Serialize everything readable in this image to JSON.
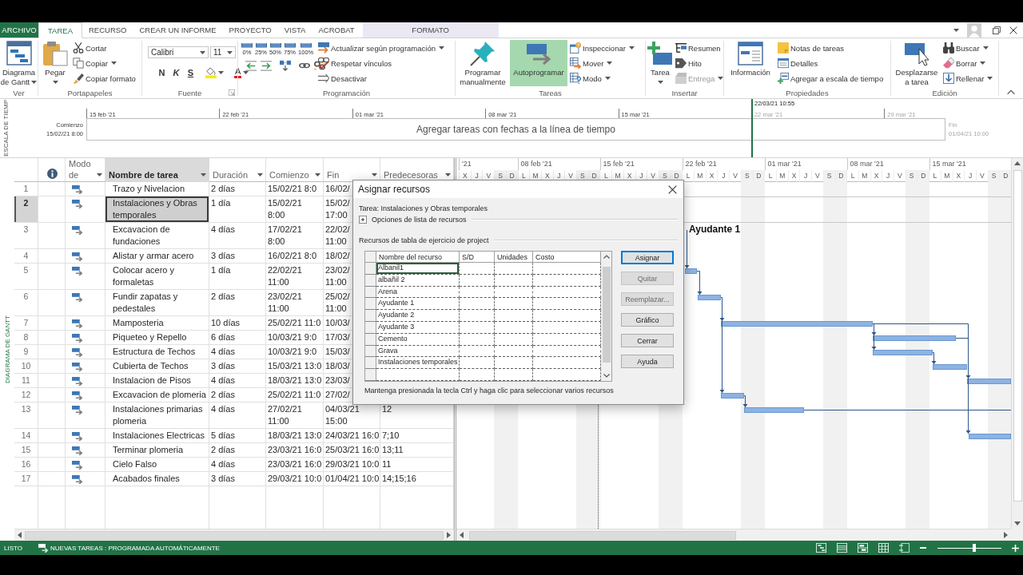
{
  "ribbon": {
    "tabs": [
      {
        "label": "ARCHIVO",
        "kind": "file",
        "selected": false
      },
      {
        "label": "TAREA",
        "kind": "tab",
        "selected": true
      },
      {
        "label": "RECURSO",
        "kind": "tab",
        "selected": false
      },
      {
        "label": "CREAR UN INFORME",
        "kind": "tab",
        "selected": false
      },
      {
        "label": "PROYECTO",
        "kind": "tab",
        "selected": false
      },
      {
        "label": "VISTA",
        "kind": "tab",
        "selected": false
      },
      {
        "label": "ACROBAT",
        "kind": "tab",
        "selected": false
      },
      {
        "label": "FORMATO",
        "kind": "contextual",
        "selected": false
      }
    ],
    "groups": [
      {
        "label": "Ver",
        "large": [
          {
            "label": "Diagrama de Gantt",
            "dropdown": true
          }
        ]
      },
      {
        "label": "Portapapeles",
        "large": [
          {
            "label": "Pegar",
            "dropdown": true
          }
        ],
        "small": [
          {
            "label": "Cortar",
            "dropdown": false
          },
          {
            "label": "Copiar",
            "dropdown": true
          },
          {
            "label": "Copiar formato",
            "dropdown": false
          }
        ]
      },
      {
        "label": "Fuente",
        "font": "Calibri",
        "size": "11",
        "format": [
          {
            "label": "N",
            "dropdown": false
          },
          {
            "label": "K",
            "dropdown": false
          },
          {
            "label": "S",
            "dropdown": false
          },
          {
            "dropdown": true
          },
          {
            "label": "A",
            "dropdown": true
          }
        ]
      },
      {
        "label": "Programación",
        "percent": [
          "0%",
          "25%",
          "50%",
          "75%",
          "100%"
        ],
        "small": [
          {
            "label": "Actualizar según programación",
            "dropdown": true
          },
          {
            "label": "Respetar vínculos",
            "dropdown": false
          },
          {
            "label": "Desactivar",
            "dropdown": false
          }
        ]
      },
      {
        "label": "Tareas",
        "large": [
          {
            "label": "Programar manualmente",
            "selected": false
          },
          {
            "label": "Autoprogramar",
            "selected": true
          }
        ],
        "small": [
          {
            "label": "Inspeccionar",
            "dropdown": true
          },
          {
            "label": "Mover",
            "dropdown": true
          },
          {
            "label": "Modo",
            "dropdown": true
          }
        ]
      },
      {
        "label": "Insertar",
        "large": [
          {
            "label": "Tarea",
            "dropdown": true
          }
        ],
        "small": [
          {
            "label": "Resumen",
            "dropdown": false,
            "disabled": false
          },
          {
            "label": "Hito",
            "dropdown": false,
            "disabled": false
          },
          {
            "label": "Entrega",
            "dropdown": true,
            "disabled": true
          }
        ]
      },
      {
        "label": "Propiedades",
        "large": [
          {
            "label": "Información"
          }
        ],
        "small": [
          {
            "label": "Notas de tareas"
          },
          {
            "label": "Detalles"
          },
          {
            "label": "Agregar a escala de tiempo"
          }
        ]
      },
      {
        "label": "Edición",
        "large": [
          {
            "label": "Desplazarse a tarea"
          }
        ],
        "small": [
          {
            "label": "Buscar",
            "dropdown": true
          },
          {
            "label": "Borrar",
            "dropdown": true
          },
          {
            "label": "Rellenar",
            "dropdown": true
          }
        ]
      }
    ]
  },
  "timeline": {
    "side_label": "ESCALA DE TIEMP",
    "current_date": "22/03/21 10:55",
    "ticks": [
      {
        "label": "15 feb '21",
        "dimmed": false
      },
      {
        "label": "22 feb '21",
        "dimmed": false
      },
      {
        "label": "01 mar '21",
        "dimmed": false
      },
      {
        "label": "08 mar '21",
        "dimmed": false
      },
      {
        "label": "15 mar '21",
        "dimmed": false
      },
      {
        "label": "22 mar '21",
        "dimmed": true
      },
      {
        "label": "29 mar '21",
        "dimmed": true
      }
    ],
    "start": {
      "label": "Comienzo",
      "date": "15/02/21 8:00"
    },
    "finish": {
      "label": "Fin",
      "date": "01/04/21 10:00"
    },
    "empty_message": "Agregar tareas con fechas a la línea de tiempo"
  },
  "gantt_view": {
    "side_label": "DIAGRAMA DE GANTT",
    "columns": [
      {
        "label": "Modo de",
        "selected": false
      },
      {
        "label": "Nombre de tarea",
        "selected": true
      },
      {
        "label": "Duración",
        "selected": false
      },
      {
        "label": "Comienzo",
        "selected": false
      },
      {
        "label": "Fin",
        "selected": false
      },
      {
        "label": "Predecesoras",
        "selected": false
      }
    ],
    "tasks": [
      {
        "id": "1",
        "name": "Trazo y Nivelacion",
        "duration": "2 días",
        "start": "15/02/21 8:0",
        "finish": "16/02/",
        "selected": false
      },
      {
        "id": "2",
        "name": "Instalaciones y Obras temporales",
        "duration": "1 día",
        "start": "15/02/21\n8:00",
        "finish": "15/02/\n17:00",
        "selected": true
      },
      {
        "id": "3",
        "name": "Excavacion de fundaciones",
        "duration": "4 días",
        "start": "17/02/21\n8:00",
        "finish": "22/02/\n11:00",
        "selected": false,
        "resource_names": "Ayudante 1"
      },
      {
        "id": "4",
        "name": "Alistar y armar acero",
        "duration": "3 días",
        "start": "16/02/21 8:0",
        "finish": "18/02/",
        "selected": false
      },
      {
        "id": "5",
        "name": "Colocar acero y formaletas",
        "duration": "1 día",
        "start": "22/02/21\n11:00",
        "finish": "23/02/\n11:00",
        "selected": false
      },
      {
        "id": "6",
        "name": "Fundir zapatas y pedestales",
        "duration": "2 días",
        "start": "23/02/21\n11:00",
        "finish": "25/02/\n11:00",
        "selected": false
      },
      {
        "id": "7",
        "name": "Mamposteria",
        "duration": "10 días",
        "start": "25/02/21 11:0",
        "finish": "10/03/",
        "selected": false
      },
      {
        "id": "8",
        "name": "Piqueteo y Repello",
        "duration": "6 días",
        "start": "10/03/21 9:0",
        "finish": "17/03/",
        "selected": false
      },
      {
        "id": "9",
        "name": "Estructura de Techos",
        "duration": "4 días",
        "start": "10/03/21 9:0",
        "finish": "15/03/",
        "selected": false
      },
      {
        "id": "10",
        "name": "Cubierta de Techos",
        "duration": "3 días",
        "start": "15/03/21 13:0",
        "finish": "18/03/",
        "selected": false
      },
      {
        "id": "11",
        "name": "Instalacion de Pisos",
        "duration": "4 días",
        "start": "18/03/21 13:0",
        "finish": "23/03/",
        "selected": false
      },
      {
        "id": "12",
        "name": "Excavacion de plomeria",
        "duration": "2 días",
        "start": "25/02/21 11:0",
        "finish": "27/02/",
        "selected": false
      },
      {
        "id": "13",
        "name": "Instalaciones primarias plomeria",
        "duration": "4 días",
        "start": "27/02/21\n11:00",
        "finish": "04/03/21\n15:00",
        "predecessors": "12",
        "selected": false
      },
      {
        "id": "14",
        "name": "Instalaciones Electricas",
        "duration": "5 días",
        "start": "18/03/21 13:0",
        "finish": "24/03/21 16:0",
        "predecessors": "7;10",
        "selected": false
      },
      {
        "id": "15",
        "name": "Terminar plomeria",
        "duration": "2 días",
        "start": "23/03/21 16:0",
        "finish": "25/03/21 16:0",
        "predecessors": "13;11",
        "selected": false
      },
      {
        "id": "16",
        "name": "Cielo Falso",
        "duration": "4 días",
        "start": "23/03/21 16:0",
        "finish": "29/03/21 10:0",
        "predecessors": "11",
        "selected": false
      },
      {
        "id": "17",
        "name": "Acabados finales",
        "duration": "3 días",
        "start": "29/03/21 10:0",
        "finish": "01/04/21 10:0",
        "predecessors": "14;15;16",
        "selected": false
      }
    ],
    "timescale": {
      "weeks": [
        {
          "label": "'21",
          "days": [
            {
              "label": "X",
              "nonworking": false
            },
            {
              "label": "J",
              "nonworking": false
            },
            {
              "label": "V",
              "nonworking": false
            },
            {
              "label": "S",
              "nonworking": true
            },
            {
              "label": "D",
              "nonworking": true
            }
          ]
        },
        {
          "label": "08 feb '21",
          "days": [
            {
              "label": "L",
              "nonworking": false
            },
            {
              "label": "M",
              "nonworking": false
            },
            {
              "label": "X",
              "nonworking": false
            },
            {
              "label": "J",
              "nonworking": false
            },
            {
              "label": "V",
              "nonworking": false
            },
            {
              "label": "S",
              "nonworking": true
            },
            {
              "label": "D",
              "nonworking": true
            }
          ]
        },
        {
          "label": "15 feb '21",
          "days": [
            {
              "label": "L",
              "nonworking": false
            },
            {
              "label": "M",
              "nonworking": false
            },
            {
              "label": "X",
              "nonworking": false
            },
            {
              "label": "J",
              "nonworking": false
            },
            {
              "label": "V",
              "nonworking": false
            },
            {
              "label": "S",
              "nonworking": true
            },
            {
              "label": "D",
              "nonworking": true
            }
          ]
        },
        {
          "label": "22 feb '21",
          "days": [
            {
              "label": "L",
              "nonworking": false
            },
            {
              "label": "M",
              "nonworking": false
            },
            {
              "label": "X",
              "nonworking": false
            },
            {
              "label": "J",
              "nonworking": false
            },
            {
              "label": "V",
              "nonworking": false
            },
            {
              "label": "S",
              "nonworking": true
            },
            {
              "label": "D",
              "nonworking": true
            }
          ]
        },
        {
          "label": "01 mar '21",
          "days": [
            {
              "label": "L",
              "nonworking": false
            },
            {
              "label": "M",
              "nonworking": false
            },
            {
              "label": "X",
              "nonworking": false
            },
            {
              "label": "J",
              "nonworking": false
            },
            {
              "label": "V",
              "nonworking": false
            },
            {
              "label": "S",
              "nonworking": true
            },
            {
              "label": "D",
              "nonworking": true
            }
          ]
        },
        {
          "label": "08 mar '21",
          "days": [
            {
              "label": "L",
              "nonworking": false
            },
            {
              "label": "M",
              "nonworking": false
            },
            {
              "label": "X",
              "nonworking": false
            },
            {
              "label": "J",
              "nonworking": false
            },
            {
              "label": "V",
              "nonworking": false
            },
            {
              "label": "S",
              "nonworking": true
            },
            {
              "label": "D",
              "nonworking": true
            }
          ]
        },
        {
          "label": "15 mar '21",
          "days": [
            {
              "label": "L",
              "nonworking": false
            },
            {
              "label": "M",
              "nonworking": false
            },
            {
              "label": "X",
              "nonworking": false
            },
            {
              "label": "J",
              "nonworking": false
            },
            {
              "label": "V",
              "nonworking": false
            },
            {
              "label": "S",
              "nonworking": true
            },
            {
              "label": "D",
              "nonworking": true
            }
          ]
        }
      ]
    }
  },
  "assign_dialog": {
    "title": "Asignar recursos",
    "task_label": "Tarea: Instalaciones y Obras temporales",
    "options_label": "Opciones de lista de recursos",
    "options_expanded": false,
    "section_label": "Recursos de tabla de ejercicio de project",
    "columns": [
      "Nombre del recurso",
      "S/D",
      "Unidades",
      "Costo"
    ],
    "resources": [
      {
        "name": "Albanil1",
        "selected": true
      },
      {
        "name": "albañil 2",
        "selected": false
      },
      {
        "name": "Arena",
        "selected": false
      },
      {
        "name": "Ayudante 1",
        "selected": false
      },
      {
        "name": "Ayudante 2",
        "selected": false
      },
      {
        "name": "Ayudante 3",
        "selected": false
      },
      {
        "name": "Cemento",
        "selected": false
      },
      {
        "name": "Grava",
        "selected": false
      },
      {
        "name": "Instalaciones temporales",
        "selected": false
      }
    ],
    "buttons": [
      {
        "label": "Asignar",
        "default": true,
        "disabled": false
      },
      {
        "label": "Quitar",
        "default": false,
        "disabled": true
      },
      {
        "label": "Reemplazar...",
        "default": false,
        "disabled": true
      },
      {
        "label": "Gráfico",
        "default": false,
        "disabled": false
      },
      {
        "label": "Cerrar",
        "default": false,
        "disabled": false
      },
      {
        "label": "Ayuda",
        "default": false,
        "disabled": false
      }
    ],
    "hint": "Mantenga presionada la tecla Ctrl y haga clic para seleccionar varios recursos"
  },
  "status_bar": {
    "mode": "LISTO",
    "new_tasks": "NUEVAS TAREAS : PROGRAMADA AUTOMÁTICAMENTE",
    "zoom": {
      "level": 0.58
    }
  }
}
